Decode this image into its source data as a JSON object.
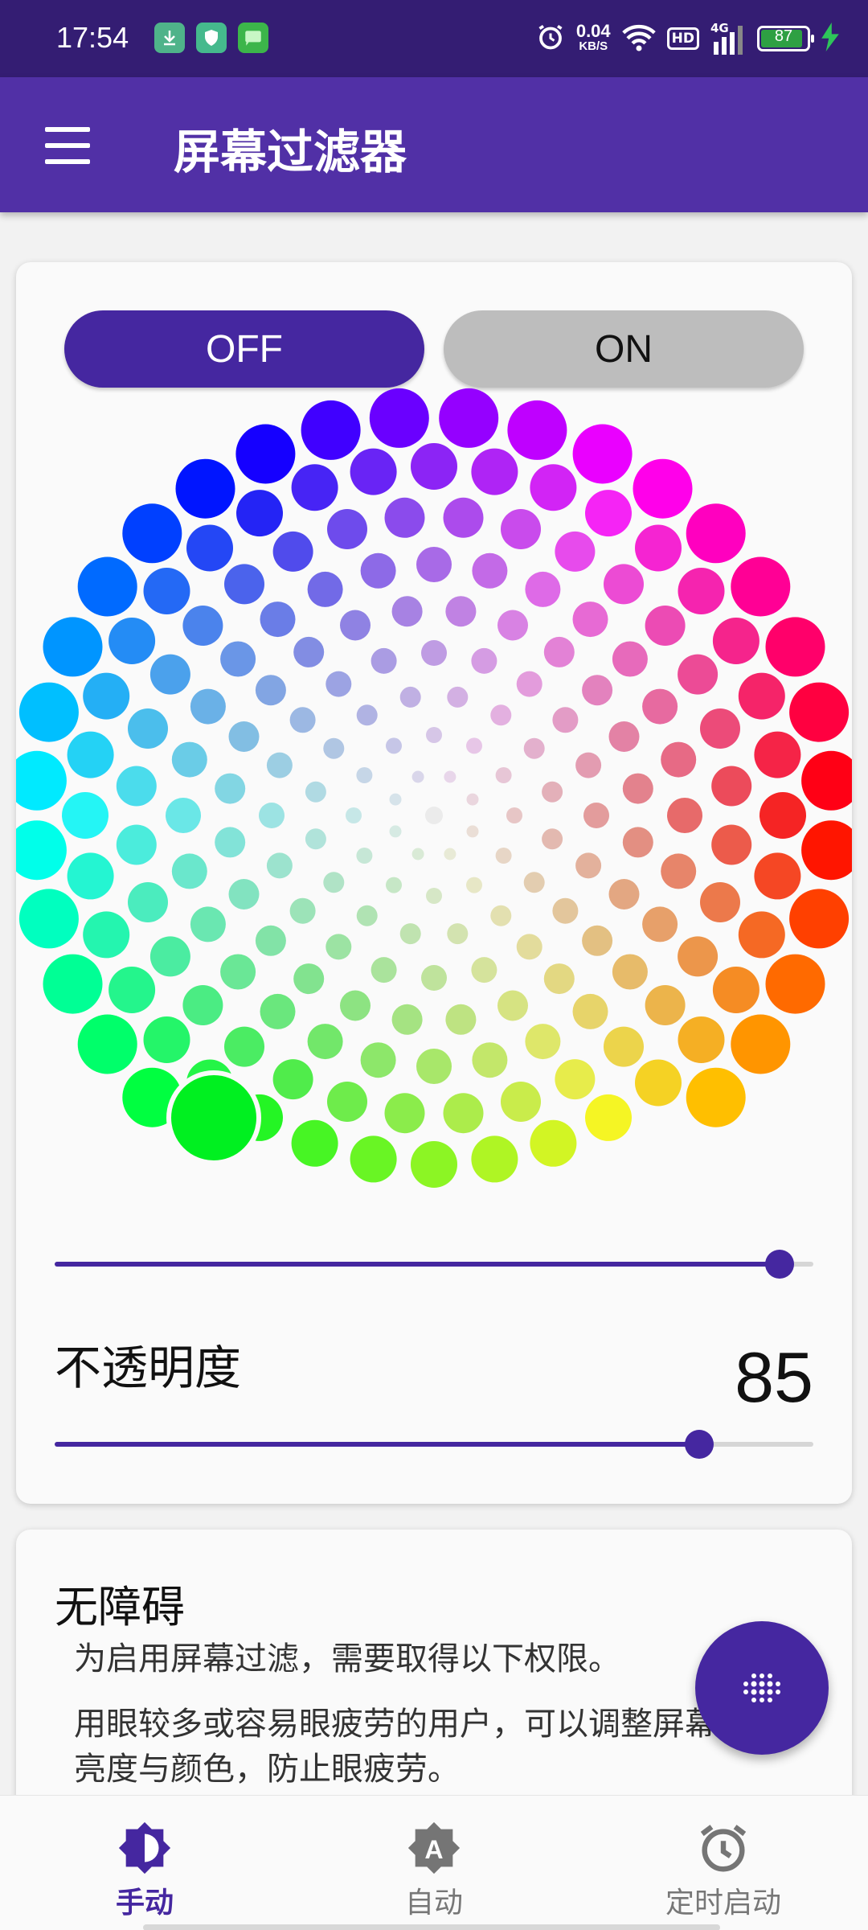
{
  "status_bar": {
    "time": "17:54",
    "net_speed_value": "0.04",
    "net_speed_unit": "KB/S",
    "hd_label": "HD",
    "signal_label": "4G",
    "battery_level": "87",
    "battery_color": "#2ea043",
    "notification_icons": [
      "download-icon",
      "shield-app-icon",
      "message-app-icon"
    ]
  },
  "app_bar": {
    "title": "屏幕过滤器",
    "background": "#5130a6"
  },
  "toggle": {
    "off_label": "OFF",
    "on_label": "ON",
    "selected": "OFF"
  },
  "color_wheel": {
    "selected_color": "#00f020"
  },
  "color_slider": {
    "level": 0.955
  },
  "opacity": {
    "label": "不透明度",
    "value": "85"
  },
  "accessibility": {
    "title": "无障碍",
    "line1": "为启用屏幕过滤，需要取得以下权限。",
    "paragraph": "用眼较多或容易眼疲劳的用户，可以调整屏幕亮度与颜色，防止眼疲劳。"
  },
  "bottom_nav": {
    "items": [
      {
        "label": "手动",
        "icon": "brightness-half-icon",
        "active": true
      },
      {
        "label": "自动",
        "icon": "auto-brightness-icon",
        "active": false
      },
      {
        "label": "定时启动",
        "icon": "alarm-clock-icon",
        "active": false
      }
    ]
  },
  "theme": {
    "primary": "#4527a0",
    "status_bar": "#341d73"
  }
}
